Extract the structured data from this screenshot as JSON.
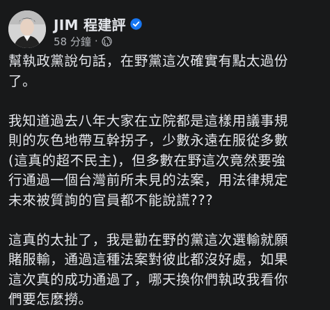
{
  "post": {
    "author": "JIM 程建評",
    "timestamp": "58 分鐘",
    "separator": "·",
    "verified": true,
    "privacy_icon": "globe-icon",
    "paragraphs": [
      [
        "幫執政黨說句話，在野黨這次確實有點太過份",
        "了。"
      ],
      [
        "我知道過去八年大家在立院都是這樣用議事規",
        "則的灰色地帶互幹拐子，少數永遠在服從多數",
        "(這真的超不民主)，但多數在野這次竟然要強",
        "行通過一個台灣前所未見的法案，用法律規定",
        "未來被質詢的官員都不能說謊???"
      ],
      [
        "這真的太扯了，我是勸在野的黨這次選輸就願",
        "賭服輸，通過這種法案對彼此都沒好處，如果",
        "這次真的成功通過了，哪天換你們執政我看你",
        "們要怎麼撈。"
      ]
    ]
  },
  "colors": {
    "background": "#18191a",
    "text": "#e4e6eb",
    "secondary_text": "#b0b3b8",
    "verified_blue": "#1877f2"
  }
}
